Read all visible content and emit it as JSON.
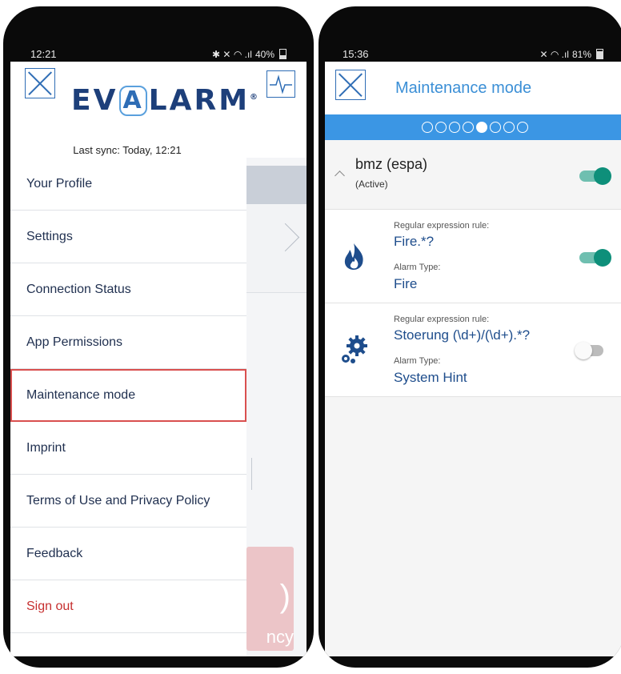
{
  "left": {
    "status": {
      "time": "12:21",
      "icons": "✱ ✕ ◠ .ıl",
      "battery": "40%"
    },
    "logo": {
      "pre": "EV",
      "a": "A",
      "post": "LARM",
      "mark": "®"
    },
    "last_sync": "Last sync: Today, 12:21",
    "menu": [
      "Your Profile",
      "Settings",
      "Connection Status",
      "App Permissions",
      "Maintenance mode",
      "Imprint",
      "Terms of Use and Privacy Policy",
      "Feedback",
      "Sign out"
    ],
    "background_text": {
      "big": ")",
      "small": "ncy"
    }
  },
  "right": {
    "status": {
      "time": "15:36",
      "icons": "✕ ◠ .ıl",
      "battery": "81%"
    },
    "title": "Maintenance mode",
    "steps": {
      "total": 8,
      "current": 5
    },
    "group": {
      "name": "bmz (espa)",
      "status": "(Active)",
      "enabled": true
    },
    "rules": [
      {
        "icon": "fire-icon",
        "rule_label": "Regular expression rule:",
        "rule": "Fire.*?",
        "type_label": "Alarm Type:",
        "type": "Fire",
        "enabled": true
      },
      {
        "icon": "gears-icon",
        "rule_label": "Regular expression rule:",
        "rule": "Stoerung (\\d+)/(\\d+).*?",
        "type_label": "Alarm Type:",
        "type": "System Hint",
        "enabled": false
      }
    ]
  },
  "colors": {
    "brand": "#1d3f7a",
    "accent": "#3b96e4",
    "toggle_on": "#0e8f7a",
    "signout": "#c62f2f",
    "highlight": "#d9504f"
  }
}
